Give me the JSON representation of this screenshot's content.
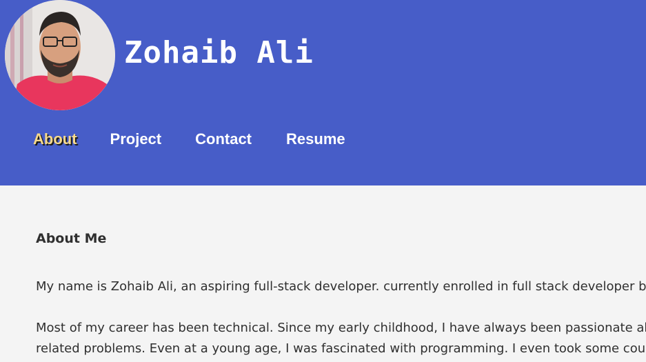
{
  "header": {
    "site_title": "Zohaib Ali",
    "avatar_alt": "profile photo"
  },
  "nav": {
    "items": [
      {
        "label": "About",
        "active": true
      },
      {
        "label": "Project",
        "active": false
      },
      {
        "label": "Contact",
        "active": false
      },
      {
        "label": "Resume",
        "active": false
      }
    ]
  },
  "about": {
    "title": "About Me",
    "paragraph1": "My name is Zohaib Ali, an aspiring full-stack developer. currently enrolled in full stack developer boo",
    "paragraph2_line1": "Most of my career has been technical. Since my early childhood, I have always been passionate abou",
    "paragraph2_line2": "related problems. Even at a young age, I was fascinated with programming. I even took some courses"
  },
  "colors": {
    "header_bg": "#475dc8",
    "page_bg": "#f4f4f4",
    "nav_active": "#f6d98b",
    "text": "#2f2f2f"
  }
}
